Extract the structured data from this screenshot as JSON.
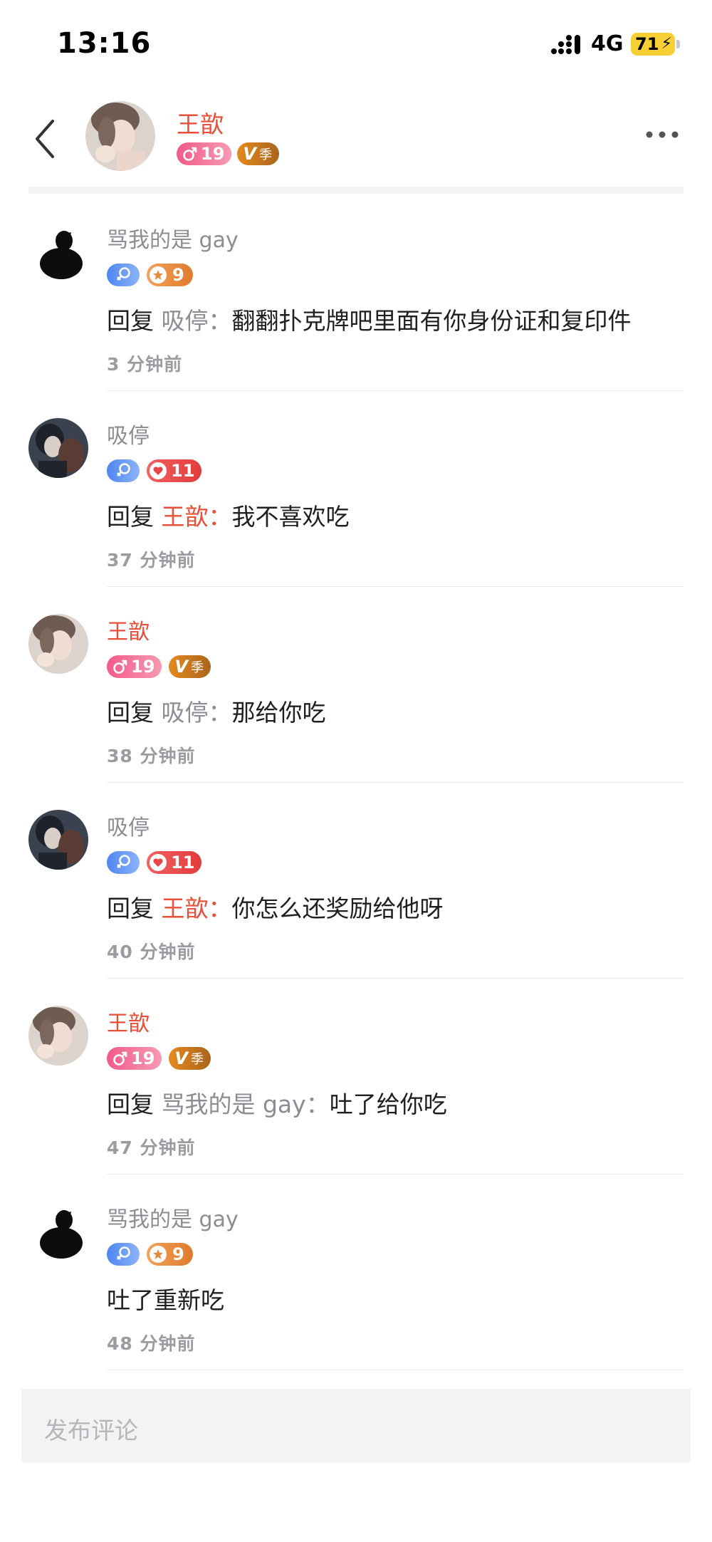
{
  "status_bar": {
    "time": "13:16",
    "network": "4G",
    "battery": "71"
  },
  "header": {
    "name": "王歆",
    "gender_age": "19",
    "vip_season": "季",
    "icons": {
      "back": "chevron-left-icon",
      "more": "more-horizontal-icon"
    }
  },
  "colors": {
    "accent_red": "#e8503a",
    "muted_gray": "#8c8c94",
    "input_bg": "#f3f3f4"
  },
  "comments": [
    {
      "name": "骂我的是 gay",
      "name_color": "gray",
      "badges": {
        "type": "female-star",
        "level": "9"
      },
      "reply_prefix": "回复 ",
      "reply_target": "吸停：",
      "text": "翻翻扑克牌吧里面有你身份证和复印件",
      "time": "3 分钟前"
    },
    {
      "name": "吸停",
      "name_color": "gray",
      "badges": {
        "type": "female-heart",
        "level": "11"
      },
      "reply_prefix": "回复 ",
      "reply_target": "王歆：",
      "text": "我不喜欢吃",
      "time": "37 分钟前"
    },
    {
      "name": "王歆",
      "name_color": "red",
      "badges": {
        "type": "male-vip",
        "level": "19",
        "vip": "季"
      },
      "reply_prefix": "回复 ",
      "reply_target": "吸停：",
      "text": "那给你吃",
      "time": "38 分钟前"
    },
    {
      "name": "吸停",
      "name_color": "gray",
      "badges": {
        "type": "female-heart",
        "level": "11"
      },
      "reply_prefix": "回复 ",
      "reply_target": "王歆：",
      "text": "你怎么还奖励给他呀",
      "time": "40 分钟前"
    },
    {
      "name": "王歆",
      "name_color": "red",
      "badges": {
        "type": "male-vip",
        "level": "19",
        "vip": "季"
      },
      "reply_prefix": "回复 ",
      "reply_target": "骂我的是 gay：",
      "text": "吐了给你吃",
      "time": "47 分钟前"
    },
    {
      "name": "骂我的是 gay",
      "name_color": "gray",
      "badges": {
        "type": "female-star",
        "level": "9"
      },
      "reply_prefix": "",
      "reply_target": "",
      "text": "吐了重新吃",
      "time": "48 分钟前"
    }
  ],
  "input": {
    "placeholder": "发布评论"
  }
}
